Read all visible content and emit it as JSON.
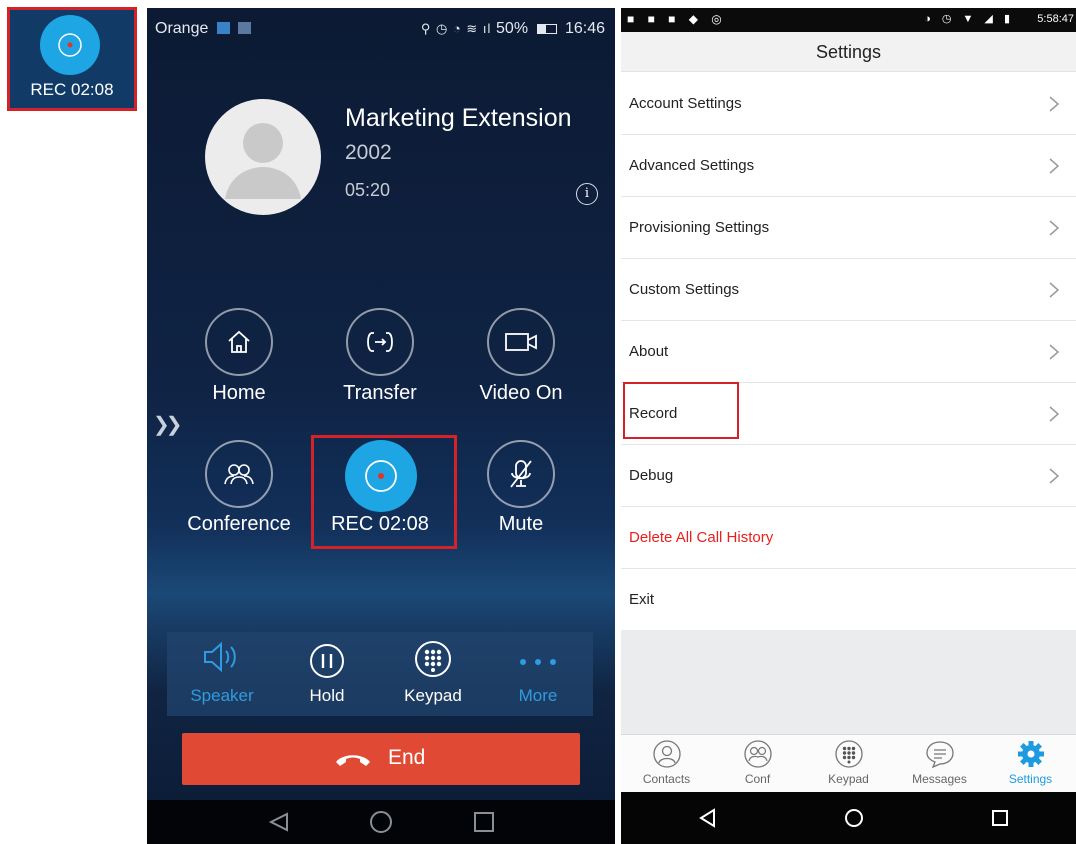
{
  "zoom_inset": {
    "rec_label": "REC 02:08"
  },
  "call_screen": {
    "status_bar": {
      "carrier": "Orange",
      "battery": "50%",
      "time": "16:46"
    },
    "contact": {
      "name": "Marketing Extension",
      "extension": "2002",
      "duration": "05:20"
    },
    "controls": [
      {
        "label": "Home",
        "icon": "home-icon"
      },
      {
        "label": "Transfer",
        "icon": "transfer-icon"
      },
      {
        "label": "Video On",
        "icon": "video-icon"
      },
      {
        "label": "Conference",
        "icon": "conference-icon"
      },
      {
        "label": "REC 02:08",
        "icon": "record-icon"
      },
      {
        "label": "Mute",
        "icon": "mute-icon"
      }
    ],
    "toolbar": [
      {
        "label": "Speaker",
        "icon": "speaker-icon",
        "color": "#2f9be0"
      },
      {
        "label": "Hold",
        "icon": "pause-icon",
        "color": "#ffffff"
      },
      {
        "label": "Keypad",
        "icon": "keypad-icon",
        "color": "#ffffff"
      },
      {
        "label": "More",
        "icon": "more-icon",
        "color": "#2f9be0"
      }
    ],
    "end_label": "End"
  },
  "settings_screen": {
    "status_time": "5:58:47",
    "title": "Settings",
    "items": [
      {
        "label": "Account Settings",
        "has_chevron": true
      },
      {
        "label": "Advanced Settings",
        "has_chevron": true
      },
      {
        "label": "Provisioning Settings",
        "has_chevron": true
      },
      {
        "label": "Custom Settings",
        "has_chevron": true
      },
      {
        "label": "About",
        "has_chevron": true
      },
      {
        "label": "Record",
        "has_chevron": true
      },
      {
        "label": "Debug",
        "has_chevron": true
      },
      {
        "label": "Delete All Call History",
        "has_chevron": false,
        "color": "#e8201e"
      },
      {
        "label": "Exit",
        "has_chevron": false
      }
    ],
    "tabs": [
      {
        "label": "Contacts",
        "icon": "contacts-icon"
      },
      {
        "label": "Conf",
        "icon": "conference-icon"
      },
      {
        "label": "Keypad",
        "icon": "keypad-icon"
      },
      {
        "label": "Messages",
        "icon": "messages-icon"
      },
      {
        "label": "Settings",
        "icon": "gear-icon",
        "active": true
      }
    ]
  },
  "colors": {
    "accent": "#1ea5e3",
    "highlight": "#d3222a",
    "end_button": "#e04a35"
  }
}
